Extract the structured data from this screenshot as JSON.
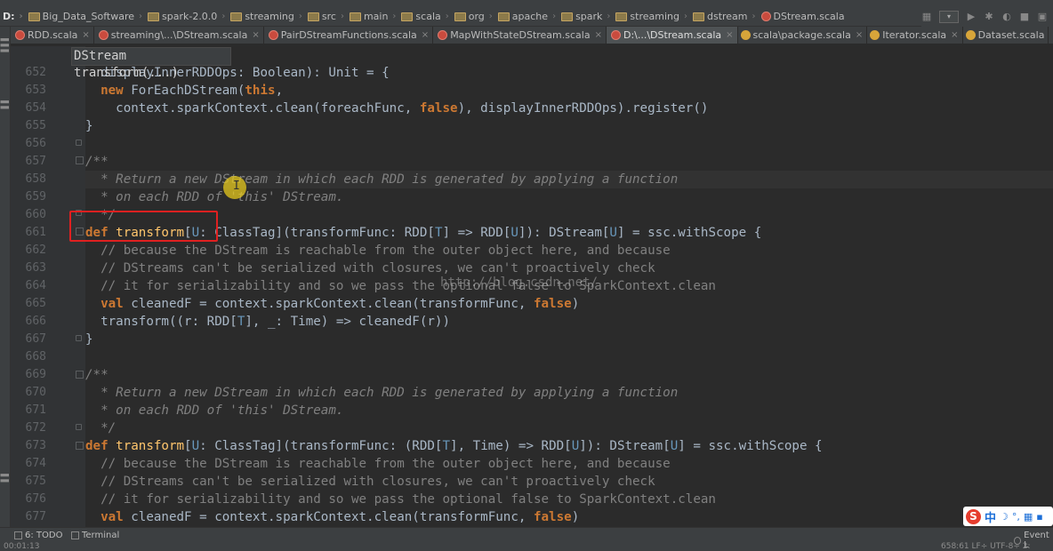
{
  "navbar": {
    "drive": "D:",
    "crumbs": [
      "Big_Data_Software",
      "spark-2.0.0",
      "streaming",
      "src",
      "main",
      "scala",
      "org",
      "apache",
      "spark",
      "streaming",
      "dstream"
    ],
    "file": "DStream.scala"
  },
  "tabs": [
    {
      "label": "RDD.scala",
      "icon": "scala",
      "active": false
    },
    {
      "label": "streaming\\...\\DStream.scala",
      "icon": "scala",
      "active": false
    },
    {
      "label": "PairDStreamFunctions.scala",
      "icon": "scala",
      "active": false
    },
    {
      "label": "MapWithStateDStream.scala",
      "icon": "scala",
      "active": false
    },
    {
      "label": "D:\\...\\DStream.scala",
      "icon": "scala",
      "active": true
    },
    {
      "label": "scala\\package.scala",
      "icon": "object",
      "active": false
    },
    {
      "label": "Iterator.scala",
      "icon": "object",
      "active": false
    },
    {
      "label": "Dataset.scala",
      "icon": "object",
      "active": false
    }
  ],
  "breadcrumb_popup": "DStream transform(...)",
  "line_numbers": [
    "652",
    "653",
    "654",
    "655",
    "656",
    "657",
    "658",
    "659",
    "660",
    "661",
    "662",
    "663",
    "664",
    "665",
    "666",
    "667",
    "668",
    "669",
    "670",
    "671",
    "672",
    "673",
    "674",
    "675",
    "676",
    "677"
  ],
  "watermark": "http://blog.csdn.net/",
  "status": {
    "todo": "6: TODO",
    "terminal": "Terminal",
    "event_log": "Event L",
    "position": "658:61  LF÷  UTF-8÷  2:",
    "time": "00:01:13"
  },
  "ime": {
    "zh": "中"
  },
  "colors": {
    "background": "#2b2b2b",
    "keyword": "#cc7832",
    "type": "#6897bb",
    "comment": "#808080",
    "doc": "#629755",
    "highlight_box": "#e02020"
  }
}
